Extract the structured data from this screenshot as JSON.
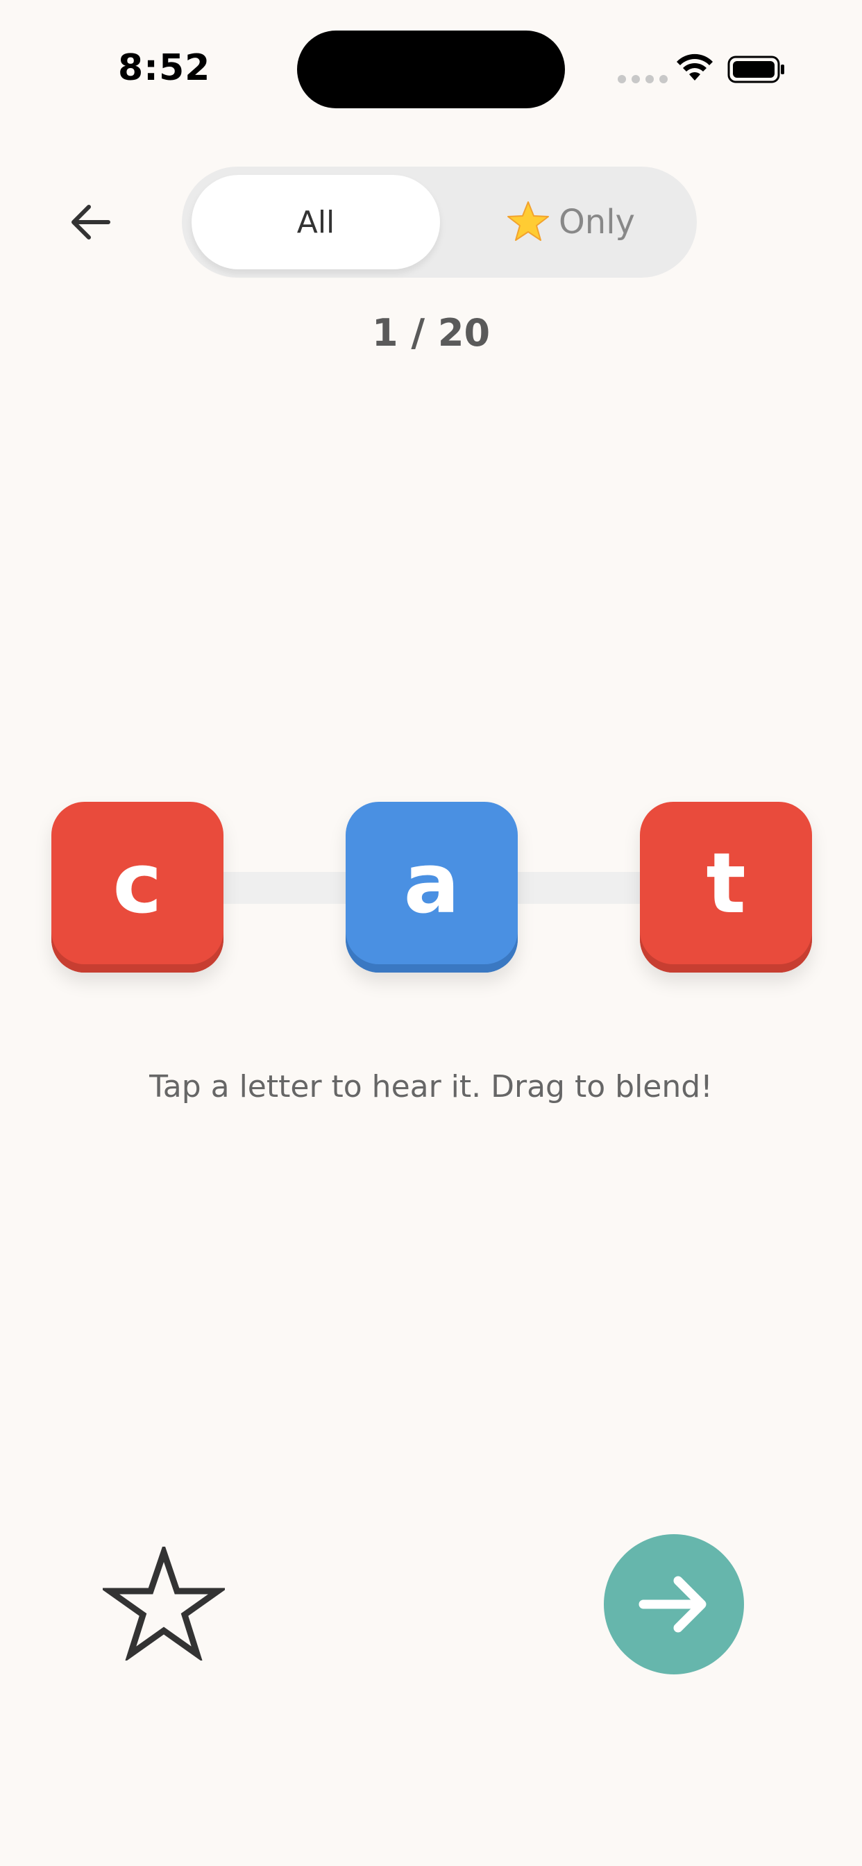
{
  "status_bar": {
    "time": "8:52"
  },
  "header": {
    "back_icon": "arrow-left-icon",
    "filter": {
      "all_label": "All",
      "only_label": "Only",
      "only_icon": "star-emoji-icon",
      "selected": "All"
    }
  },
  "progress": {
    "text": "1 / 20",
    "current": 1,
    "total": 20
  },
  "word": {
    "letters": [
      {
        "char": "c",
        "color": "#E94B3C",
        "shade": "#C73E31"
      },
      {
        "char": "a",
        "color": "#4A90E2",
        "shade": "#3A78C2"
      },
      {
        "char": "t",
        "color": "#E94B3C",
        "shade": "#C73E31"
      }
    ]
  },
  "hint": "Tap a letter to hear it. Drag to blend!",
  "footer": {
    "star_icon": "star-outline-icon",
    "next_icon": "arrow-right-icon",
    "next_color": "#66B6AC"
  },
  "colors": {
    "background": "#FCF9F6",
    "segment_bg": "#EBEBEB"
  }
}
